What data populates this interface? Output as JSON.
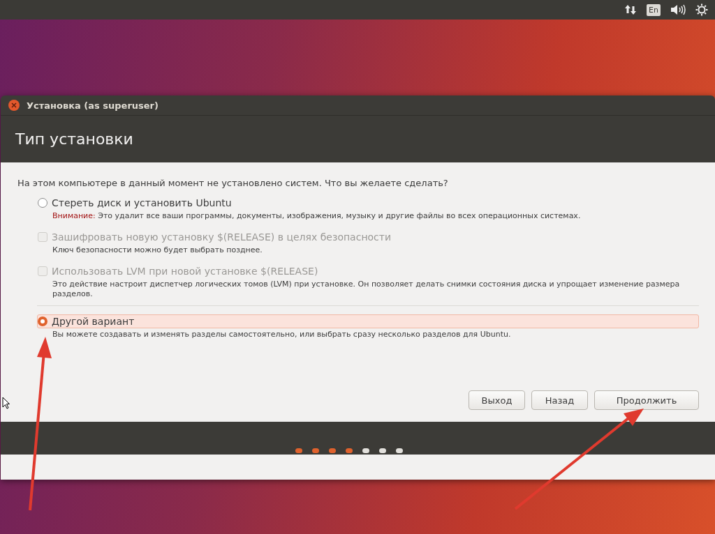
{
  "top_panel": {
    "keyboard_layout": "En"
  },
  "window": {
    "title": "Установка (as superuser)",
    "heading": "Тип установки"
  },
  "question": "На этом компьютере в данный момент не установлено систем. Что вы желаете сделать?",
  "options": [
    {
      "kind": "radio",
      "label": "Стереть диск и установить Ubuntu",
      "warning_label": "Внимание:",
      "description": "Это удалит все ваши программы, документы, изображения, музыку и другие файлы во всех операционных системах.",
      "selected": false,
      "disabled": false,
      "separated": false
    },
    {
      "kind": "checkbox",
      "label": "Зашифровать новую установку $(RELEASE) в целях безопасности",
      "description": "Ключ безопасности можно будет выбрать позднее.",
      "checked": false,
      "disabled": true,
      "separated": false
    },
    {
      "kind": "checkbox",
      "label": "Использовать LVM при новой установке $(RELEASE)",
      "description": "Это действие настроит диспетчер логических томов (LVM) при установке. Он позволяет делать снимки состояния диска и упрощает изменение размера разделов.",
      "checked": false,
      "disabled": true,
      "separated": false
    },
    {
      "kind": "radio",
      "label": "Другой вариант",
      "description": "Вы можете создавать и изменять разделы самостоятельно, или выбрать сразу несколько разделов для Ubuntu.",
      "selected": true,
      "disabled": false,
      "separated": true
    }
  ],
  "buttons": [
    "Выход",
    "Назад",
    "Продолжить"
  ],
  "progress_steps": [
    {
      "done": true
    },
    {
      "done": true
    },
    {
      "done": true
    },
    {
      "done": true
    },
    {
      "done": false
    },
    {
      "done": false
    },
    {
      "done": false
    }
  ]
}
